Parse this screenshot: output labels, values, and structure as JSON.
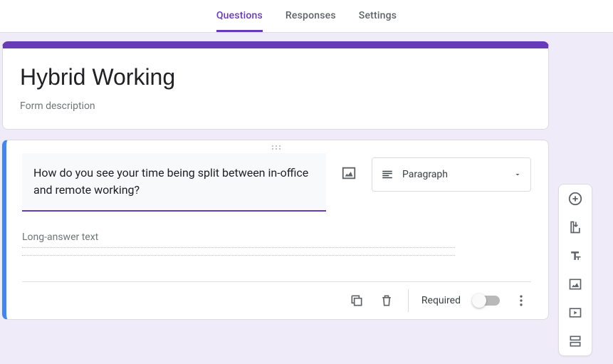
{
  "tabs": {
    "questions": "Questions",
    "responses": "Responses",
    "settings": "Settings"
  },
  "form": {
    "title": "Hybrid Working",
    "description_placeholder": "Form description"
  },
  "question": {
    "text": "How do you see your time being split between in-office and remote working?",
    "type_label": "Paragraph",
    "answer_placeholder": "Long-answer text",
    "required_label": "Required",
    "required": false
  },
  "side_tools": {
    "add": "add-question",
    "import": "import-questions",
    "title": "add-title",
    "image": "add-image",
    "video": "add-video",
    "section": "add-section"
  }
}
